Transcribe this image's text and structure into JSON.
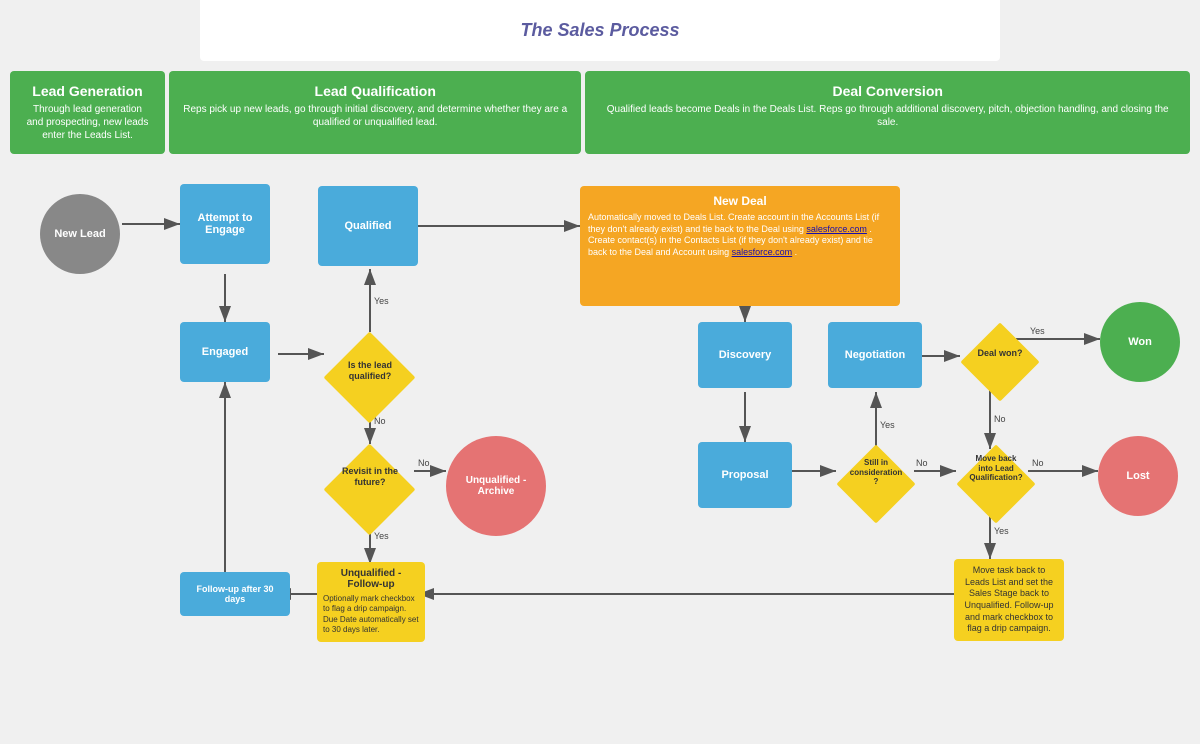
{
  "header": {
    "title": "The Sales Process"
  },
  "phases": [
    {
      "id": "lead-gen",
      "title": "Lead Generation",
      "desc": "Through lead generation and prospecting, new leads enter the Leads List."
    },
    {
      "id": "lead-qual",
      "title": "Lead Qualification",
      "desc": "Reps pick up new leads, go through initial discovery, and determine whether they are a qualified or unqualified lead."
    },
    {
      "id": "deal-conv",
      "title": "Deal Conversion",
      "desc": "Qualified leads become Deals in the Deals List. Reps go through additional discovery, pitch, objection handling, and closing the sale."
    }
  ],
  "nodes": {
    "new_lead": "New Lead",
    "attempt_to_engage": "Attempt to\nEngage",
    "engaged": "Engaged",
    "qualified": "Qualified",
    "is_lead_qualified": "Is the lead\nqualified?",
    "revisit_future": "Revisit in the\nfuture?",
    "unqualified_archive": "Unqualified -\nArchive",
    "unqualified_followup_title": "Unqualified -\nFollow-up",
    "unqualified_followup_desc": "Optionally mark checkbox to flag a drip campaign. Due Date automatically set to 30 days later.",
    "followup_30_days": "Follow-up after 30 days",
    "new_deal_title": "New Deal",
    "new_deal_desc": "Automatically moved to Deals List. Create account in the Accounts List (if they don't already exist) and tie back to the Deal using",
    "new_deal_link1": "salesforce.com",
    "new_deal_desc2": ". Create contact(s) in the Contacts List (if they don't already exist) and tie back to the Deal and Account using",
    "new_deal_link2": "salesforce.com",
    "discovery": "Discovery",
    "proposal": "Proposal",
    "negotiation": "Negotiation",
    "deal_won": "Deal won?",
    "won": "Won",
    "still_consideration": "Still in\nconsideration\n?",
    "move_back_lead_qual": "Move back\ninto Lead\nQualification?",
    "lost": "Lost",
    "move_back_desc": "Move task back to Leads List and set the Sales Stage back to Unqualified. Follow-up and mark checkbox to flag a drip campaign.",
    "labels": {
      "yes": "Yes",
      "no": "No"
    }
  }
}
